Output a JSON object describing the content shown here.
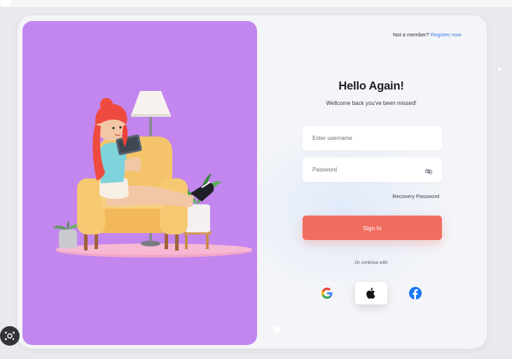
{
  "header": {
    "not_member": "Not a member?",
    "register_link": "Register now"
  },
  "login": {
    "title": "Hello Again!",
    "subtitle": "Wellcome back you've been missed!",
    "username_placeholder": "Enter username",
    "password_placeholder": "Password",
    "recovery_label": "Recovery Password",
    "signin_label": "Sign In",
    "continue_label": "Or continue with"
  },
  "social": {
    "buttons": [
      {
        "name": "google",
        "icon": "google-icon"
      },
      {
        "name": "apple",
        "icon": "apple-icon"
      },
      {
        "name": "facebook",
        "icon": "facebook-icon"
      }
    ]
  },
  "colors": {
    "accent": "#f16d60",
    "illustration_bg": "#c386ef",
    "link": "#3b7ee6",
    "facebook": "#1877f2"
  },
  "illustration": {
    "icon": "woman-on-armchair-illustration"
  }
}
